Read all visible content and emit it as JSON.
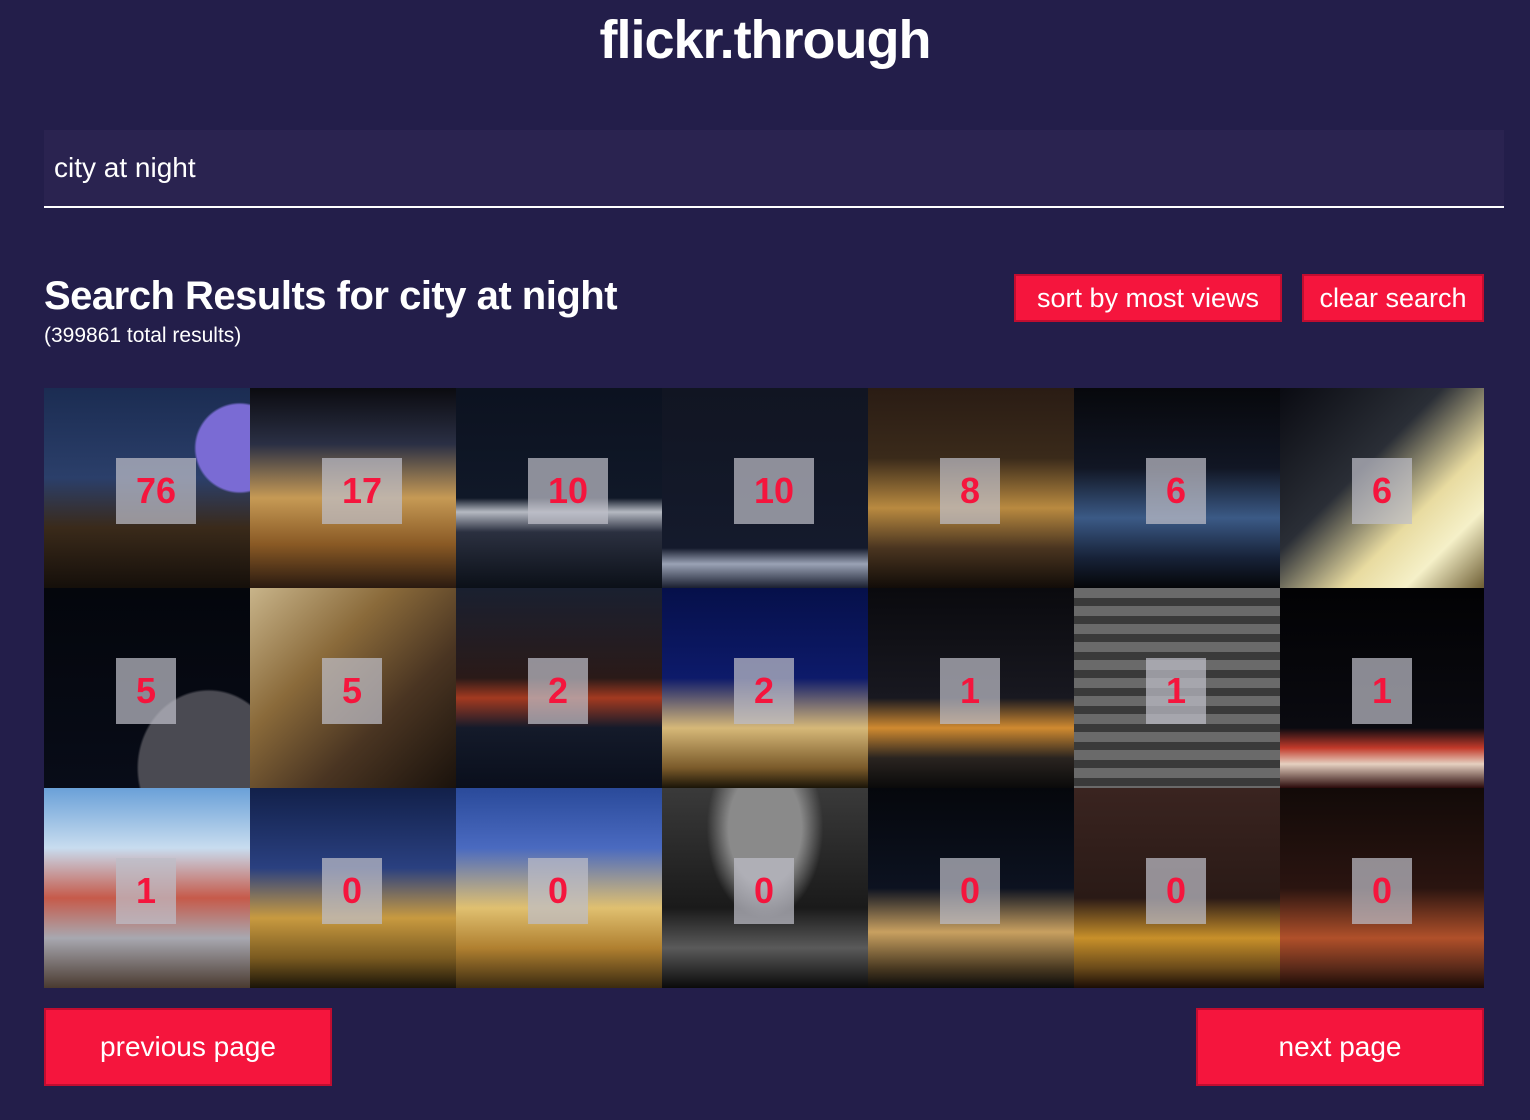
{
  "app": {
    "title": "flickr.through"
  },
  "search": {
    "value": "city at night"
  },
  "results": {
    "title": "Search Results for city at night",
    "total": "(399861 total results)"
  },
  "actions": {
    "sort_label": "sort by most views",
    "clear_label": "clear search"
  },
  "photos": [
    {
      "views": "76"
    },
    {
      "views": "17"
    },
    {
      "views": "10"
    },
    {
      "views": "10"
    },
    {
      "views": "8"
    },
    {
      "views": "6"
    },
    {
      "views": "6"
    },
    {
      "views": "5"
    },
    {
      "views": "5"
    },
    {
      "views": "2"
    },
    {
      "views": "2"
    },
    {
      "views": "1"
    },
    {
      "views": "1"
    },
    {
      "views": "1"
    },
    {
      "views": "1"
    },
    {
      "views": "0"
    },
    {
      "views": "0"
    },
    {
      "views": "0"
    },
    {
      "views": "0"
    },
    {
      "views": "0"
    },
    {
      "views": "0"
    }
  ],
  "pagination": {
    "previous_label": "previous page",
    "next_label": "next page"
  },
  "colors": {
    "background": "#231e4a",
    "accent": "#f5153d",
    "search_bg": "#2a2350"
  }
}
